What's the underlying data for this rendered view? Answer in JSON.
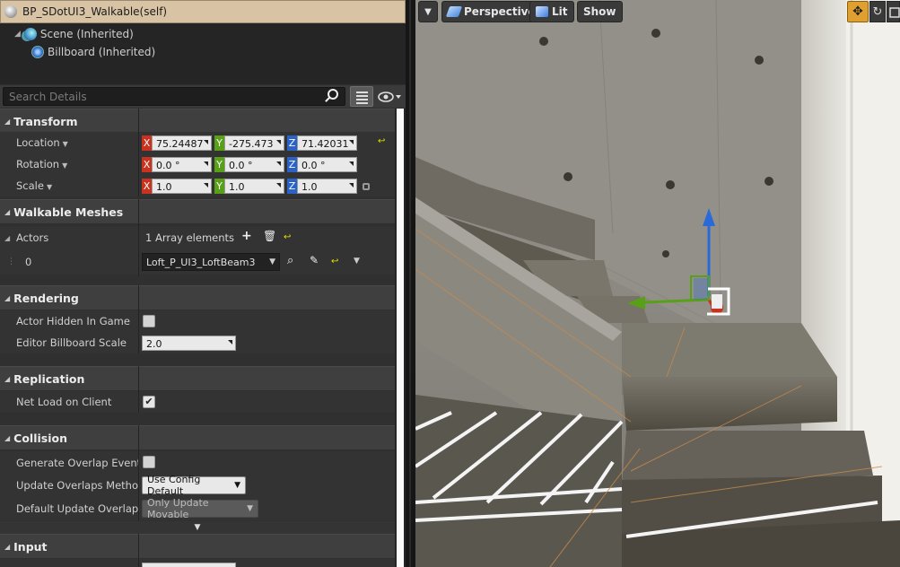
{
  "titlebar": {
    "title": "BP_SDotUI3_Walkable(self)"
  },
  "tree": {
    "items": [
      {
        "label": "Scene (Inherited)"
      },
      {
        "label": "Billboard (Inherited)"
      }
    ]
  },
  "search": {
    "placeholder": "Search Details"
  },
  "transform": {
    "header": "Transform",
    "location": {
      "label": "Location",
      "x": "75.24487",
      "y": "-275.473",
      "z": "71.42031"
    },
    "rotation": {
      "label": "Rotation",
      "x": "0.0 °",
      "y": "0.0 °",
      "z": "0.0 °"
    },
    "scale": {
      "label": "Scale",
      "x": "1.0",
      "y": "1.0",
      "z": "1.0"
    }
  },
  "axes": {
    "x": "X",
    "y": "Y",
    "z": "Z"
  },
  "walkable": {
    "header": "Walkable Meshes",
    "actors_label": "Actors",
    "array_count": "1 Array elements",
    "index0": "0",
    "element0": "Loft_P_UI3_LoftBeam3"
  },
  "rendering": {
    "header": "Rendering",
    "actor_hidden_label": "Actor Hidden In Game",
    "actor_hidden": false,
    "billboard_scale_label": "Editor Billboard Scale",
    "billboard_scale": "2.0"
  },
  "replication": {
    "header": "Replication",
    "net_load_label": "Net Load on Client",
    "net_load": true
  },
  "collision": {
    "header": "Collision",
    "gen_overlap_label": "Generate Overlap Events Du",
    "gen_overlap": false,
    "update_method_label": "Update Overlaps Method Du",
    "update_method": "Use Config Default",
    "default_update_label": "Default Update Overlaps M",
    "default_update": "Only Update Movable"
  },
  "input": {
    "header": "Input"
  },
  "viewport": {
    "menu_label": "▼",
    "perspective": "Perspective",
    "lit": "Lit",
    "show": "Show"
  },
  "colors": {
    "titlebar": "#d8c4a4",
    "x_axis": "#c8321e",
    "y_axis": "#58a018",
    "z_axis": "#2a62c8",
    "gizmo_active": "#e0a030"
  }
}
